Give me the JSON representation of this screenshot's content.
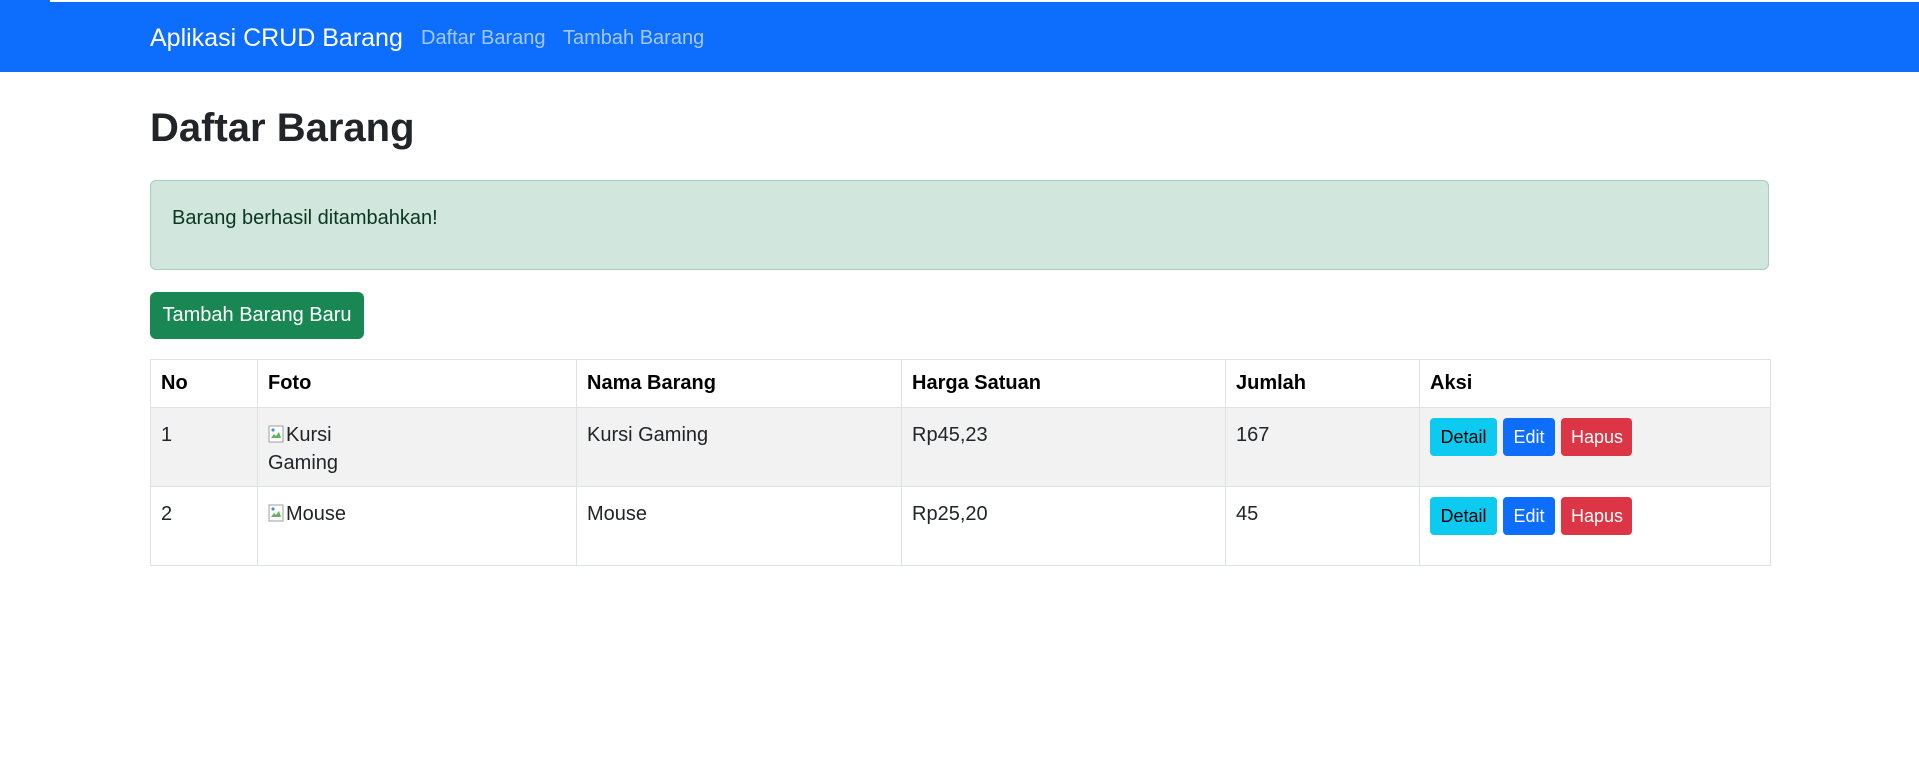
{
  "navbar": {
    "brand": "Aplikasi CRUD Barang",
    "links": [
      {
        "label": "Daftar Barang"
      },
      {
        "label": "Tambah Barang"
      }
    ],
    "background_color": "#0d6efd"
  },
  "page": {
    "title": "Daftar Barang"
  },
  "alert": {
    "message": "Barang berhasil ditambahkan!",
    "type": "success"
  },
  "add_button": {
    "label": "Tambah Barang Baru"
  },
  "table": {
    "headers": [
      "No",
      "Foto",
      "Nama Barang",
      "Harga Satuan",
      "Jumlah",
      "Aksi"
    ],
    "rows": [
      {
        "no": "1",
        "foto_alt": "Kursi Gaming",
        "nama": "Kursi Gaming",
        "harga": "Rp45,23",
        "jumlah": "167",
        "actions": {
          "detail": "Detail",
          "edit": "Edit",
          "hapus": "Hapus"
        }
      },
      {
        "no": "2",
        "foto_alt": "Mouse",
        "nama": "Mouse",
        "harga": "Rp25,20",
        "jumlah": "45",
        "actions": {
          "detail": "Detail",
          "edit": "Edit",
          "hapus": "Hapus"
        }
      }
    ]
  },
  "colors": {
    "primary": "#0d6efd",
    "success": "#198754",
    "info": "#0dcaf0",
    "danger": "#dc3545",
    "alert_bg": "#d1e7dd"
  }
}
